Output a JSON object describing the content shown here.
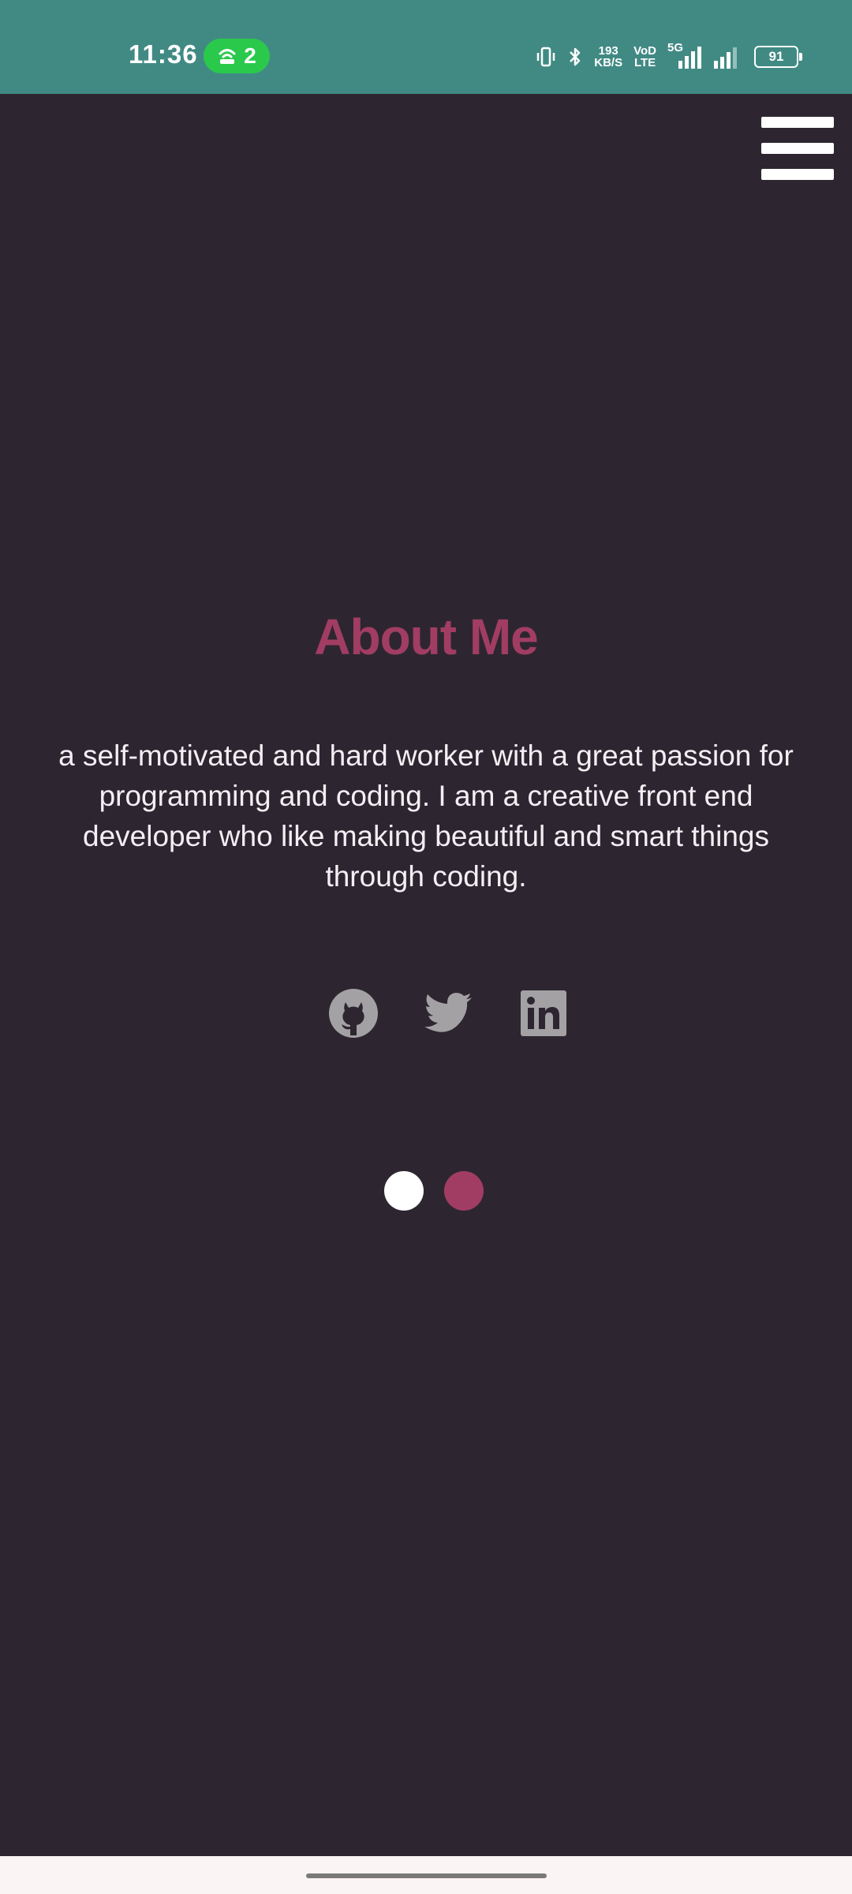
{
  "status_bar": {
    "time": "11:36",
    "hotspot_count": "2",
    "net_speed_value": "193",
    "net_speed_unit": "KB/S",
    "volte_top": "VoD",
    "volte_bottom": "LTE",
    "network_type": "5G",
    "battery": "91"
  },
  "about": {
    "title": "About Me",
    "description": "a self-motivated and hard worker with a great passion for programming and coding. I am a creative front end developer who like making beautiful and smart things through coding."
  },
  "social": [
    {
      "name": "github",
      "icon": "github-icon"
    },
    {
      "name": "twitter",
      "icon": "twitter-icon"
    },
    {
      "name": "linkedin",
      "icon": "linkedin-icon"
    }
  ],
  "colors": {
    "status_bar_bg": "#418a84",
    "page_bg": "#2d2630",
    "accent": "#a13d63",
    "icon_gray": "#a4a1a4",
    "dot_active": "#ffffff",
    "dot_inactive": "#a13d63"
  },
  "pager": {
    "count": 2,
    "active_index": 0
  }
}
